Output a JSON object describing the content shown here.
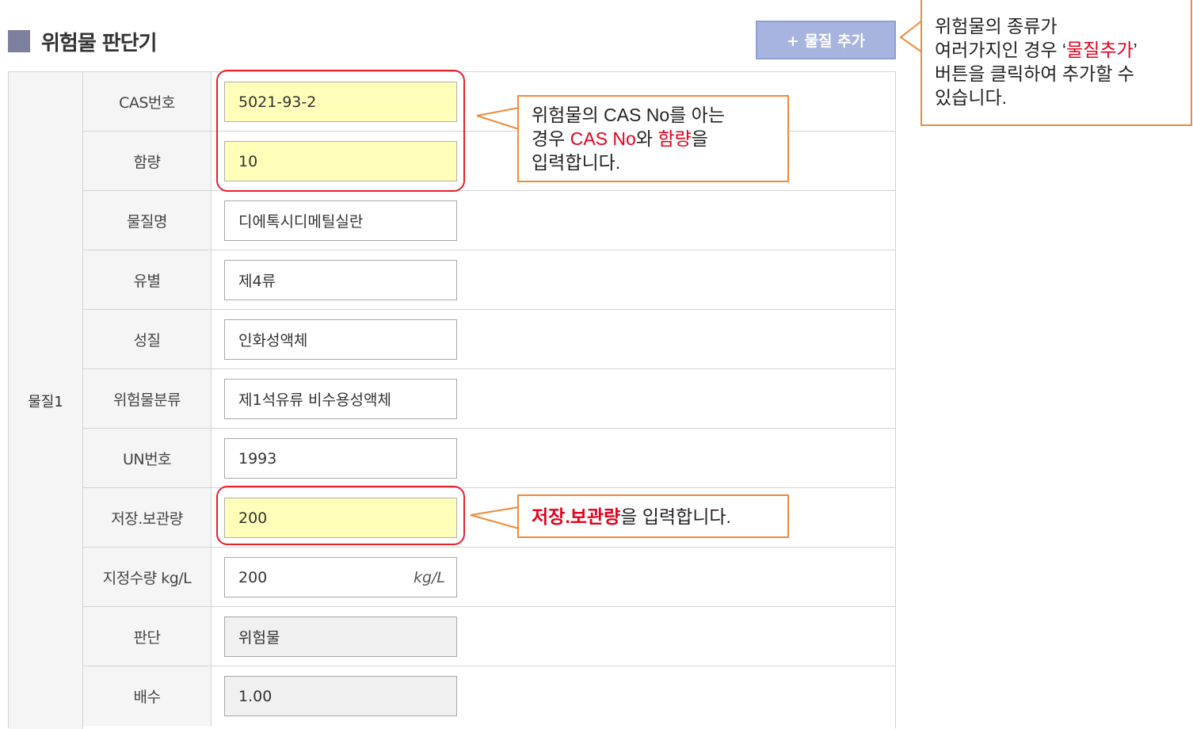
{
  "header": {
    "title": "위험물 판단기",
    "add_button": "+ 물질 추가"
  },
  "form": {
    "group_label": "물질1",
    "rows": [
      {
        "label": "CAS번호",
        "value": "5021-93-2"
      },
      {
        "label": "함량",
        "value": "10"
      },
      {
        "label": "물질명",
        "value": "디에톡시디메틸실란"
      },
      {
        "label": "유별",
        "value": "제4류"
      },
      {
        "label": "성질",
        "value": "인화성액체"
      },
      {
        "label": "위험물분류",
        "value": "제1석유류 비수용성액체"
      },
      {
        "label": "UN번호",
        "value": "1993"
      },
      {
        "label": "저장.보관량",
        "value": "200"
      },
      {
        "label": "지정수량 kg/L",
        "value": "200",
        "unit": "kg/L"
      },
      {
        "label": "판단",
        "value": "위험물"
      },
      {
        "label": "배수",
        "value": "1.00"
      }
    ]
  },
  "callouts": {
    "add": {
      "line1": "위험물의 종류가",
      "line2_a": "여러가지인 경우 ‘",
      "line2_red": "물질추가",
      "line2_b": "’",
      "line3": "버튼을 클릭하여 추가할 수",
      "line4": "있습니다."
    },
    "cas": {
      "line1": "위험물의 CAS No를 아는",
      "line2_a": "경우 ",
      "line2_red1": "CAS No",
      "line2_b": "와 ",
      "line2_red2": "함량",
      "line2_c": "을",
      "line3": "입력합니다."
    },
    "storage": {
      "red": "저장.보관량",
      "rest": "을 입력합니다."
    }
  },
  "colors": {
    "accent_title": "#7d7f9e",
    "button_bg": "#a6b4df",
    "highlight_field": "#ffffb9",
    "callout_border": "#ef8a3a",
    "highlight_red": "#e8202a"
  }
}
